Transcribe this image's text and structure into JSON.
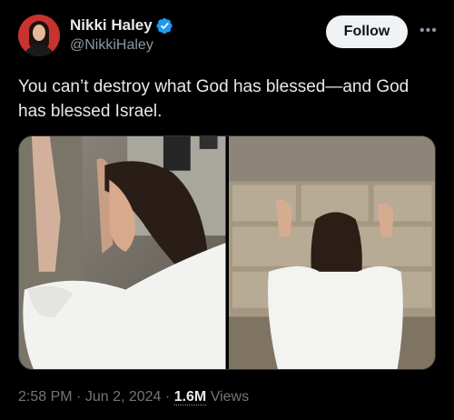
{
  "author": {
    "display_name": "Nikki Haley",
    "handle": "@NikkiHaley",
    "verified": true
  },
  "actions": {
    "follow_label": "Follow",
    "more_icon": "more-dots-icon"
  },
  "tweet": {
    "text": "You can’t destroy what God has blessed—and God has blessed Israel."
  },
  "media": {
    "photos": [
      {
        "subject": "woman in white shirt leaning forehead against stone wall"
      },
      {
        "subject": "woman in white shirt with hands on stone wall, seen from behind"
      }
    ]
  },
  "meta": {
    "time": "2:58 PM",
    "date": "Jun 2, 2024",
    "separator": "·",
    "views_count": "1.6M",
    "views_label": "Views"
  },
  "colors": {
    "background": "#000000",
    "text_primary": "#e7e9ea",
    "text_secondary": "#71767b",
    "verified_badge": "#1d9bf0",
    "follow_button_bg": "#eff3f4"
  }
}
